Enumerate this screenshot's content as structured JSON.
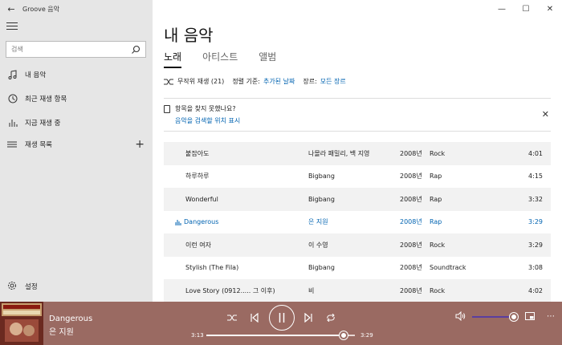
{
  "app": {
    "title": "Groove 음악",
    "back_icon": "back-arrow-icon"
  },
  "window_controls": [
    "minimize-icon",
    "maximize-icon",
    "close-icon"
  ],
  "sidebar": {
    "search": {
      "placeholder": "검색",
      "value": ""
    },
    "items": [
      {
        "label": "내 음악",
        "icon": "music-note-icon"
      },
      {
        "label": "최근 재생 항목",
        "icon": "clock-icon"
      },
      {
        "label": "지금 재생 중",
        "icon": "bars-icon"
      }
    ],
    "playlist_label": "재생 목록",
    "settings_label": "설정"
  },
  "main": {
    "title": "내 음악",
    "tabs": [
      {
        "label": "노래",
        "active": true
      },
      {
        "label": "아티스트",
        "active": false
      },
      {
        "label": "앨범",
        "active": false
      }
    ],
    "filters": {
      "shuffle_label": "무작위 재생 (21)",
      "sort_label": "정렬 기준:",
      "sort_value": "추가된 날짜",
      "genre_label": "장르:",
      "genre_value": "모든 장르"
    },
    "notice": {
      "text": "항목을 찾지 못했나요?",
      "link": "음악을 검색할 위치 표시"
    },
    "tracks": [
      {
        "title": "붙잡아도",
        "artist": "나몰라 패밀리, 백 지영",
        "year": "2008년",
        "genre": "Rock",
        "duration": "4:01"
      },
      {
        "title": "하루하루",
        "artist": "Bigbang",
        "year": "2008년",
        "genre": "Rap",
        "duration": "4:15"
      },
      {
        "title": "Wonderful",
        "artist": "Bigbang",
        "year": "2008년",
        "genre": "Rap",
        "duration": "3:32"
      },
      {
        "title": "Dangerous",
        "artist": "은 지원",
        "year": "2008년",
        "genre": "Rap",
        "duration": "3:29",
        "playing": true
      },
      {
        "title": "이런 여자",
        "artist": "이 수영",
        "year": "2008년",
        "genre": "Rock",
        "duration": "3:29"
      },
      {
        "title": "Stylish (The Fila)",
        "artist": "Bigbang",
        "year": "2008년",
        "genre": "Soundtrack",
        "duration": "3:08"
      },
      {
        "title": "Love Story (0912..... 그 이후)",
        "artist": "비",
        "year": "2008년",
        "genre": "Rock",
        "duration": "4:02"
      }
    ]
  },
  "player": {
    "title": "Dangerous",
    "artist": "은 지원",
    "time_elapsed": "3:13",
    "time_total": "3:29",
    "progress": 0.923,
    "volume": 1.0,
    "colors": {
      "bar": "#9a6a62",
      "accent": "#0063b1",
      "volume_fill": "#5a3ea0"
    }
  }
}
